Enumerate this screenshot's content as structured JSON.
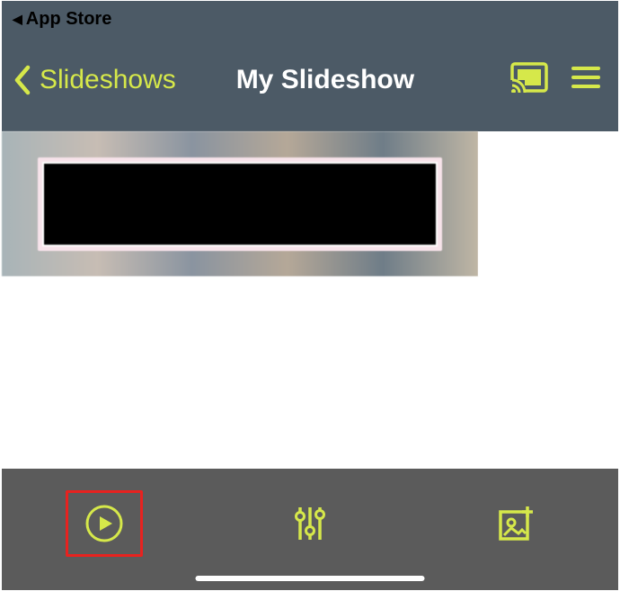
{
  "systemBack": {
    "label": "App Store"
  },
  "header": {
    "backLabel": "Slideshows",
    "title": "My Slideshow"
  },
  "colors": {
    "accent": "#d6e84a",
    "highlight": "#e8221f",
    "barBg": "#4c5a66",
    "toolbarBg": "#5b5b5b"
  },
  "toolbar": {
    "items": [
      "play",
      "adjust",
      "add-photo"
    ],
    "highlighted": "play"
  }
}
